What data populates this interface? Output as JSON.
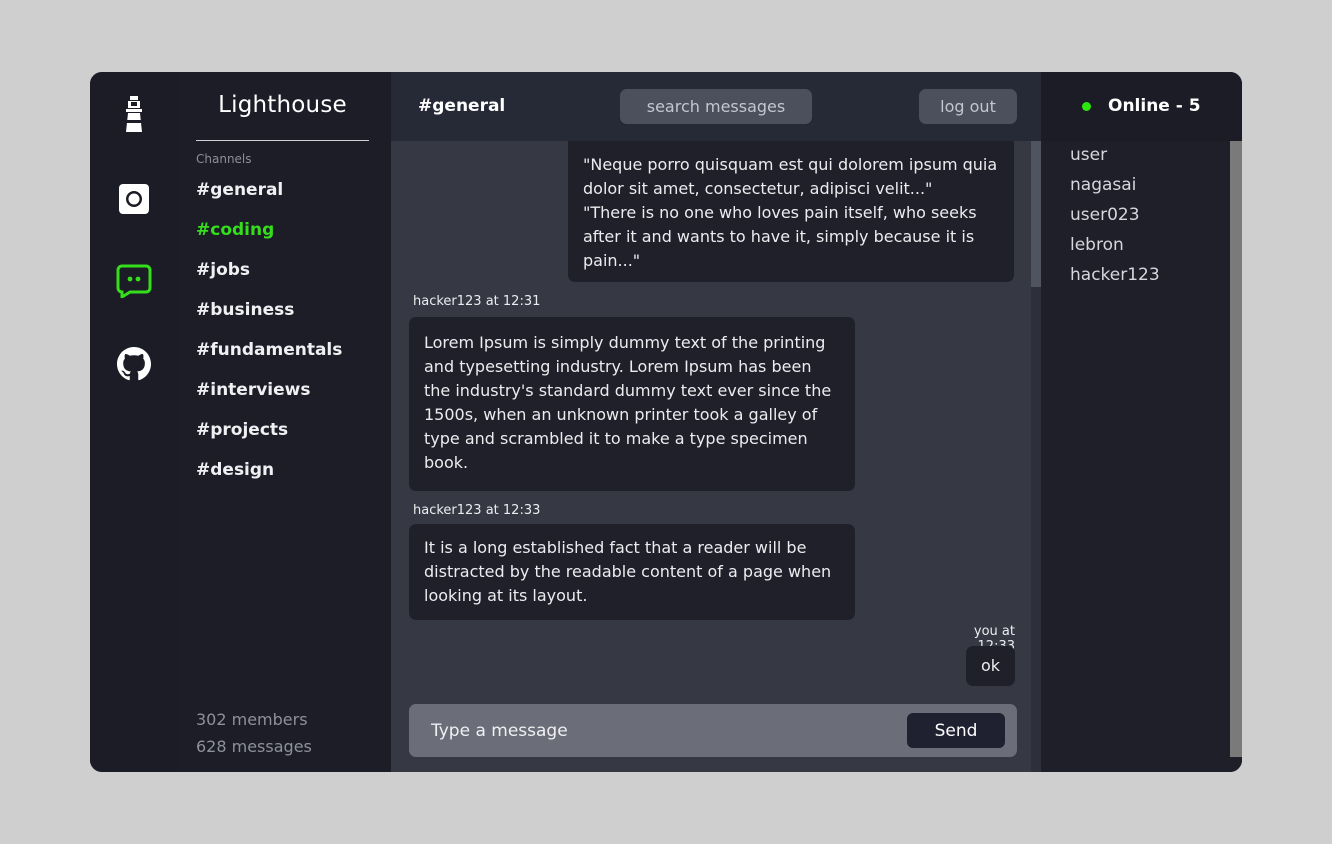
{
  "app": {
    "name": "Lighthouse"
  },
  "rail": {
    "icons": [
      "lighthouse-icon",
      "camera-icon",
      "chat-icon",
      "github-icon"
    ],
    "active_color": "#35dd1c"
  },
  "sidebar": {
    "section_label": "Channels",
    "channels": [
      {
        "label": "#general",
        "active": false
      },
      {
        "label": "#coding",
        "active": true
      },
      {
        "label": "#jobs",
        "active": false
      },
      {
        "label": "#business",
        "active": false
      },
      {
        "label": "#fundamentals",
        "active": false
      },
      {
        "label": "#interviews",
        "active": false
      },
      {
        "label": "#projects",
        "active": false
      },
      {
        "label": "#design",
        "active": false
      }
    ],
    "members_count": "302 members",
    "messages_count": "628 messages"
  },
  "header": {
    "channel": "#general",
    "search_label": "search messages",
    "logout_label": "log out"
  },
  "messages": [
    {
      "author": "",
      "text_lines": [
        "\"Neque porro quisquam est qui dolorem ipsum quia",
        "dolor sit amet, consectetur, adipisci velit...\"",
        "\"There is no one who loves pain itself, who seeks",
        "after it and wants to have it, simply because it is",
        "pain...\""
      ]
    },
    {
      "author": "hacker123 at 12:31",
      "text_lines": [
        "Lorem Ipsum is simply dummy text of the printing",
        "and typesetting industry. Lorem Ipsum has been",
        "the industry's standard dummy text ever since the",
        "1500s, when an unknown printer took a galley of",
        "type and scrambled it to make a type specimen",
        "book."
      ]
    },
    {
      "author": "hacker123 at 12:33",
      "text_lines": [
        "It is a long established fact that a reader will be",
        "distracted by the readable content of a page when",
        "looking at its layout."
      ]
    },
    {
      "author": "you at 12:33",
      "text_lines": [
        "ok"
      ]
    }
  ],
  "composer": {
    "placeholder": "Type a message",
    "send_label": "Send"
  },
  "members": {
    "online_label": "Online - 5",
    "status_color": "#2ee60f",
    "list": [
      "user",
      "nagasai",
      "user023",
      "lebron",
      "hacker123"
    ]
  }
}
